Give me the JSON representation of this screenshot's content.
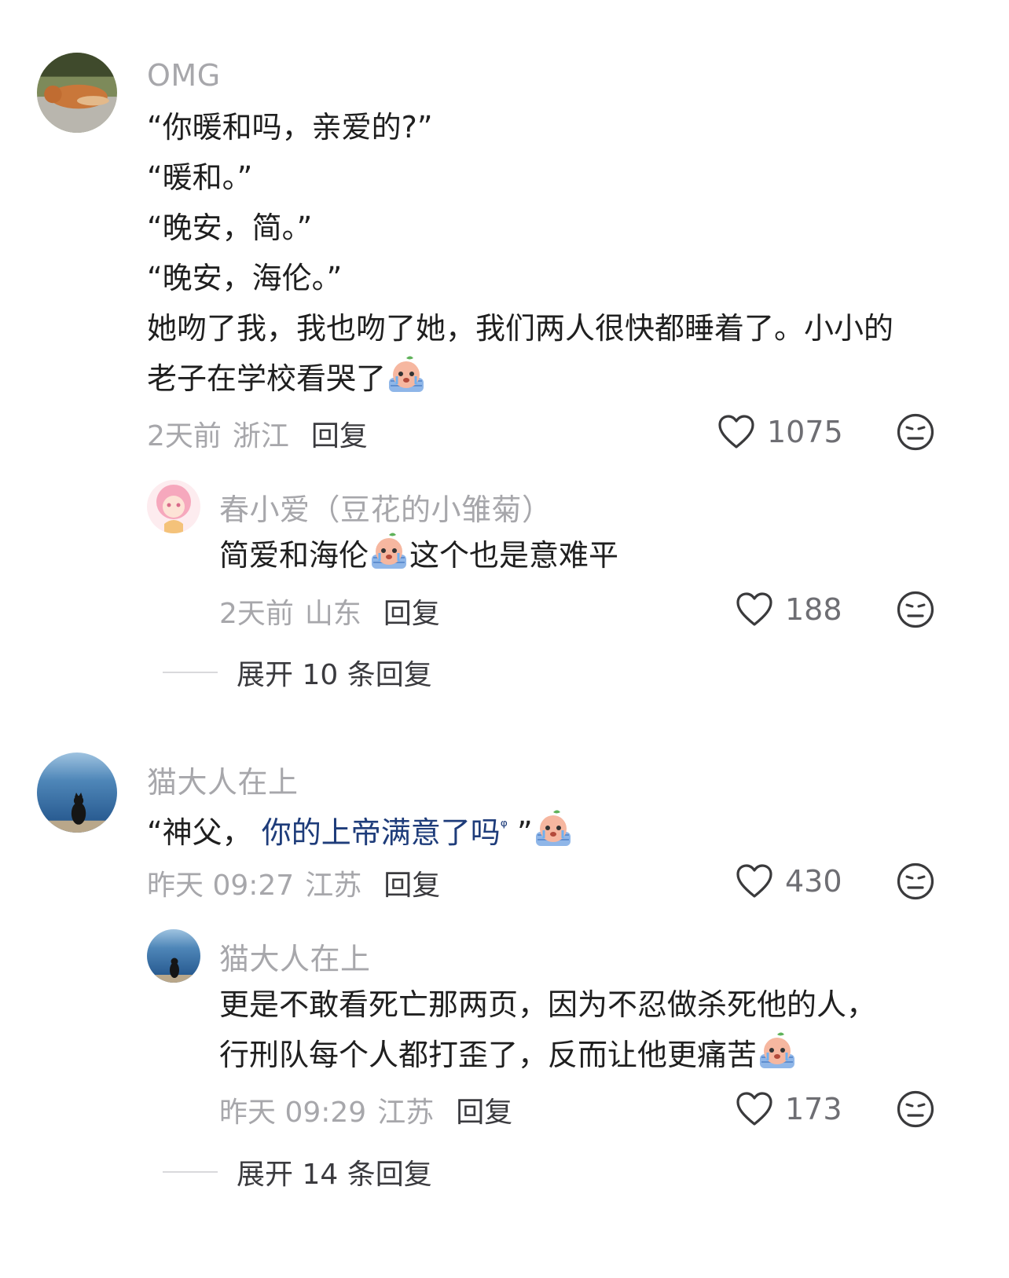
{
  "comments": [
    {
      "username": "OMG",
      "lines": [
        "“你暖和吗，亲爱的?”",
        "“暖和。”",
        "“晚安，简。”",
        "“晚安，海伦。”",
        "她吻了我，我也吻了她，我们两人很快都睡着了。小小的",
        "老子在学校看哭了"
      ],
      "time": "2天前",
      "location": "浙江",
      "reply_label": "回复",
      "likes": "1075",
      "replies": [
        {
          "username": "春小爱（豆花的小雏菊）",
          "text_before": "简爱和海伦",
          "text_after": "这个也是意难平",
          "time": "2天前",
          "location": "山东",
          "reply_label": "回复",
          "likes": "188"
        }
      ],
      "expand_label": "展开 10 条回复"
    },
    {
      "username": "猫大人在上",
      "quote_open": "“神父，",
      "link_text": "你的上帝满意了吗",
      "link_mark": "ᵠ",
      "quote_close": "”",
      "time": "昨天 09:27",
      "location": "江苏",
      "reply_label": "回复",
      "likes": "430",
      "replies": [
        {
          "username": "猫大人在上",
          "line1": "更是不敢看死亡那两页，因为不忍做杀死他的人，",
          "line2": "行刑队每个人都打歪了，反而让他更痛苦",
          "time": "昨天 09:29",
          "location": "江苏",
          "reply_label": "回复",
          "likes": "173"
        }
      ],
      "expand_label": "展开 14 条回复"
    }
  ],
  "icons": {
    "like": "heart-outline-icon",
    "dislike": "meh-face-icon",
    "emoji": "crying-peach-emoji"
  },
  "colors": {
    "username": "#a7a7ab",
    "text": "#1f1f1f",
    "link": "#1e3c7a",
    "meta": "#a7a7ab"
  }
}
